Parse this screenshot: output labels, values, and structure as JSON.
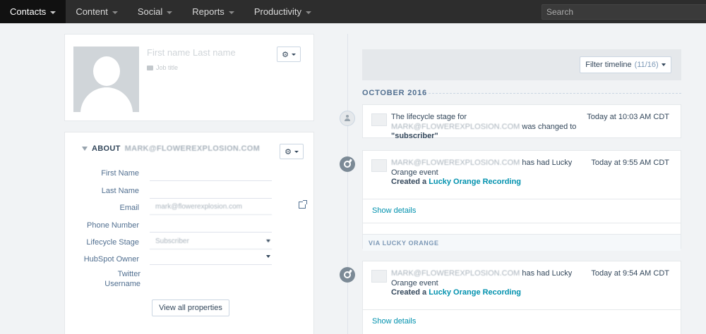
{
  "nav": {
    "items": [
      {
        "label": "Contacts",
        "active": true
      },
      {
        "label": "Content",
        "active": false
      },
      {
        "label": "Social",
        "active": false
      },
      {
        "label": "Reports",
        "active": false
      },
      {
        "label": "Productivity",
        "active": false
      }
    ],
    "search_placeholder": "Search"
  },
  "profile": {
    "name_placeholder": "First name Last name",
    "job_title_placeholder": "Job title"
  },
  "about": {
    "title_prefix": "ABOUT",
    "contact_email": "MARK@FLOWEREXPLOSION.COM",
    "properties": [
      {
        "label": "First Name",
        "value": ""
      },
      {
        "label": "Last Name",
        "value": ""
      },
      {
        "label": "Email",
        "value": "mark@flowerexplosion.com"
      },
      {
        "label": "Phone Number",
        "value": ""
      },
      {
        "label": "Lifecycle Stage",
        "value": "Subscriber"
      },
      {
        "label": "HubSpot Owner",
        "value": ""
      },
      {
        "label": "Twitter Username",
        "value": ""
      }
    ],
    "view_all_label": "View all properties"
  },
  "timeline": {
    "filter_label": "Filter timeline",
    "filter_count": "(11/16)",
    "month": "OCTOBER 2016",
    "events": [
      {
        "text_a": "The lifecycle stage for",
        "email": "MARK@FLOWEREXPLOSION.COM",
        "text_b": "was changed to",
        "value": "\"subscriber\"",
        "time": "Today at 10:03 AM CDT"
      },
      {
        "email": "MARK@FLOWEREXPLOSION.COM",
        "text_a": "has had Lucky Orange event",
        "created": "Created a",
        "link": "Lucky Orange Recording",
        "time": "Today at 9:55 AM CDT",
        "show_details": "Show details",
        "via": "VIA LUCKY ORANGE"
      },
      {
        "email": "MARK@FLOWEREXPLOSION.COM",
        "text_a": "has had Lucky Orange event",
        "created": "Created a",
        "link": "Lucky Orange Recording",
        "time": "Today at 9:54 AM CDT",
        "show_details": "Show details"
      }
    ]
  }
}
